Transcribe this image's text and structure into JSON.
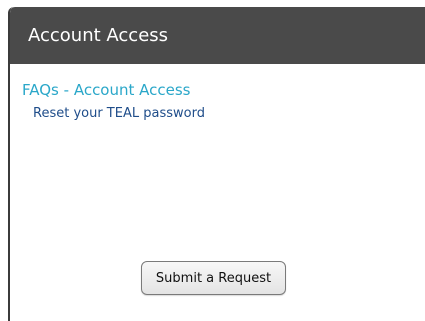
{
  "panel": {
    "title": "Account Access"
  },
  "faq": {
    "heading": "FAQs - Account Access",
    "items": [
      {
        "label": "Reset your TEAL password"
      }
    ]
  },
  "actions": {
    "submit_label": "Submit a Request"
  }
}
